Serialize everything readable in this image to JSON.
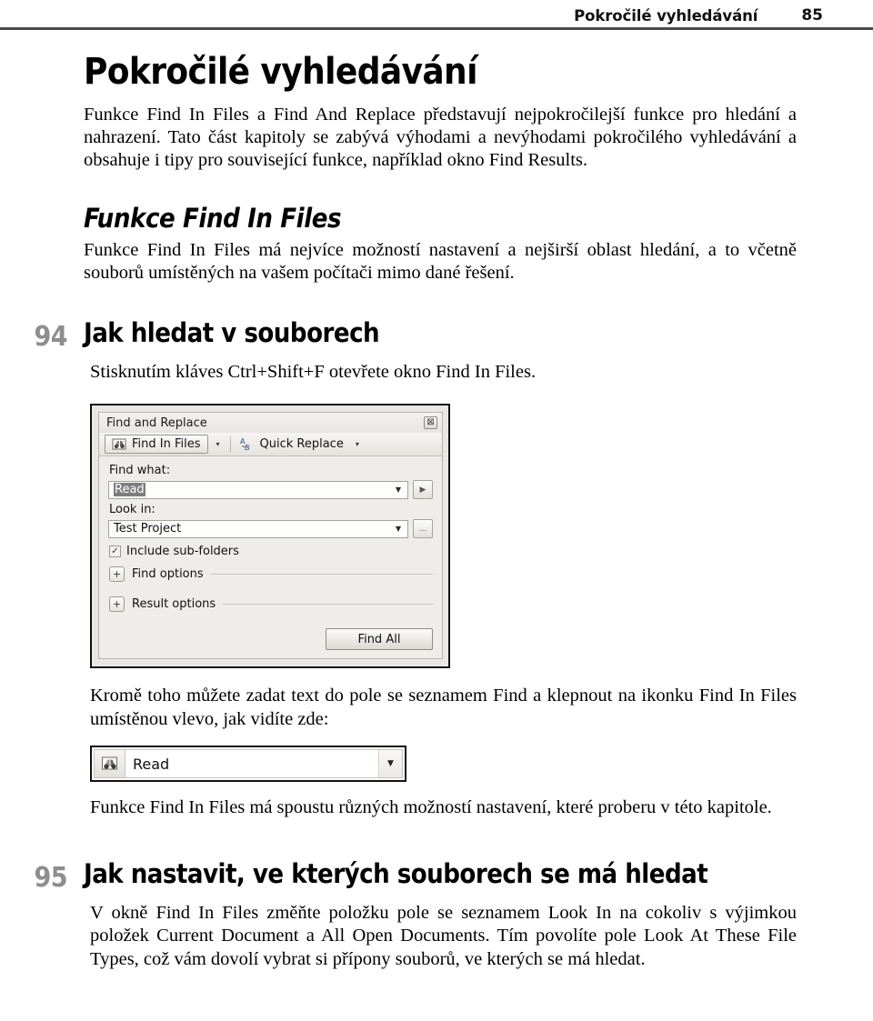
{
  "header": {
    "title": "Pokročilé vyhledávání",
    "page_number": "85"
  },
  "chapter": {
    "title": "Pokročilé vyhledávání",
    "intro": "Funkce Find In Files a Find And Replace představují nejpokročilejší funkce pro hledání a nahrazení. Tato část kapitoly se zabývá výhodami a nevýhodami pokročilého vyhledávání a obsahuje i tipy pro související funkce, například okno Find Results."
  },
  "section": {
    "title": "Funkce Find In Files",
    "paragraph": "Funkce Find In Files má nejvíce možností nastavení a nejširší oblast hledání, a to včetně souborů umístěných na vašem počítači mimo dané řešení."
  },
  "tips": [
    {
      "number": "94",
      "heading": "Jak hledat v souborech",
      "intro": "Stisknutím kláves Ctrl+Shift+F otevřete okno Find In Files.",
      "after_figure": "Kromě toho můžete zadat text do pole se seznamem Find a klepnout na ikonku Find In Files umístěnou vlevo, jak vidíte zde:",
      "closing": "Funkce Find In Files má spoustu různých možností nastavení, které proberu v této kapitole."
    },
    {
      "number": "95",
      "heading": "Jak nastavit, ve kterých souborech se má hledat",
      "body": "V okně Find In Files změňte položku pole se seznamem Look In na cokoliv s výjimkou položek Current Document a All Open Documents. Tím povolíte pole Look At These File Types, což vám dovolí vybrat si přípony souborů, ve kterých se má hledat."
    }
  ],
  "dialog": {
    "title": "Find and Replace",
    "close_label": "⊠",
    "toolbar": {
      "find_in_files_label": "Find In Files",
      "find_in_files_caret": "▾",
      "quick_replace_label": "Quick Replace",
      "quick_replace_caret": "▾",
      "quick_replace_icon_top": "A",
      "quick_replace_icon_bottom": "B"
    },
    "find_what": {
      "label": "Find what:",
      "value": "Read",
      "arrow": "▼",
      "action_button": "▶"
    },
    "look_in": {
      "label": "Look in:",
      "value": "Test Project",
      "arrow": "▼",
      "browse_button": "..."
    },
    "include_subfolders": {
      "label": "Include sub-folders",
      "checked_mark": "✓"
    },
    "groups": [
      {
        "label": "Find options",
        "expander": "+"
      },
      {
        "label": "Result options",
        "expander": "+"
      }
    ],
    "find_all_button": "Find All"
  },
  "combo_figure": {
    "value": "Read",
    "arrow": "▼",
    "icon": "find-in-files-icon"
  },
  "colors": {
    "rule": "#4a4a4a",
    "tip_number": "#8e8e8e",
    "dialog_face": "#efedea",
    "selection": "#7d7d7d"
  }
}
